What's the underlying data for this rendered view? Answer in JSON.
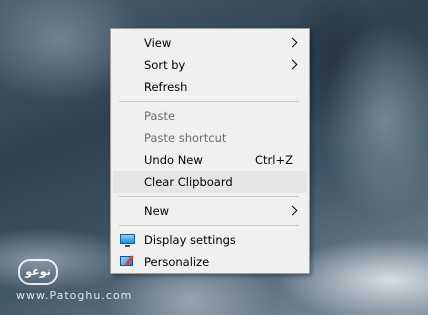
{
  "watermark": {
    "logo_text": "ﺗﻮﻏﻮ",
    "url": "www.Patoghu.com"
  },
  "context_menu": {
    "items": [
      {
        "label": "View",
        "submenu": true,
        "enabled": true
      },
      {
        "label": "Sort by",
        "submenu": true,
        "enabled": true
      },
      {
        "label": "Refresh",
        "enabled": true
      },
      {
        "label": "Paste",
        "enabled": false
      },
      {
        "label": "Paste shortcut",
        "enabled": false
      },
      {
        "label": "Undo New",
        "shortcut": "Ctrl+Z",
        "enabled": true
      },
      {
        "label": "Clear Clipboard",
        "enabled": true,
        "highlighted": true
      },
      {
        "label": "New",
        "submenu": true,
        "enabled": true
      },
      {
        "label": "Display settings",
        "icon": "display-settings-icon",
        "enabled": true
      },
      {
        "label": "Personalize",
        "icon": "personalize-icon",
        "enabled": true
      }
    ]
  },
  "colors": {
    "menu_background": "#f0f0f0",
    "highlight": "#e5e5e5",
    "disabled_text": "#6d6d6d"
  }
}
